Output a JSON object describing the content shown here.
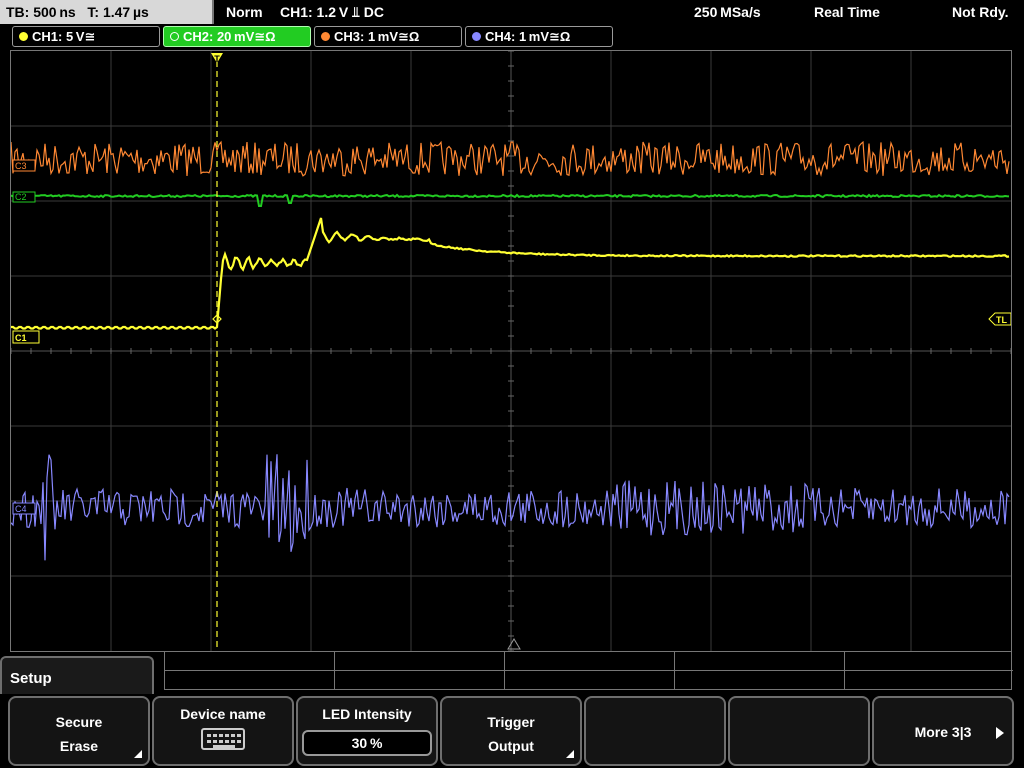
{
  "status": {
    "timebase": "TB: 500 ns",
    "trigger_time": "T: 1.47 µs",
    "mode": "Norm",
    "trigger_info": "CH1: 1.2 V ⫫ DC",
    "sample_rate": "250 MSa/s",
    "acq_mode": "Real Time",
    "state": "Not Rdy."
  },
  "channels": [
    {
      "label": "CH1: 5 V≅",
      "color": "#ffff33",
      "active": false
    },
    {
      "label": "CH2: 20 mV≅Ω",
      "color": "#22cc22",
      "active": true
    },
    {
      "label": "CH3: 1 mV≅Ω",
      "color": "#ff8833",
      "active": false
    },
    {
      "label": "CH4: 1 mV≅Ω",
      "color": "#8888ff",
      "active": false
    }
  ],
  "screen_markers": {
    "trigger_marker": "T",
    "ch1_ref": "C1",
    "ch3_ref": "C3",
    "ch2_ref": "C2",
    "ch4_ref": "C4",
    "trigger_level": "TL"
  },
  "menu": {
    "title": "Setup",
    "softkeys": [
      {
        "line1": "Secure",
        "line2": "Erase",
        "has_submenu": true
      },
      {
        "line1": "Device name",
        "icon": "keyboard-icon"
      },
      {
        "line1": "LED Intensity",
        "value": "30 %"
      },
      {
        "line1": "Trigger",
        "line2": "Output",
        "has_submenu": true
      },
      {
        "line1": ""
      },
      {
        "line1": ""
      },
      {
        "line1": "More 3|3",
        "icon": "arrow-right-icon"
      }
    ]
  },
  "colors": {
    "ch1": "#ffff33",
    "ch2": "#22cc22",
    "ch3": "#ff8833",
    "ch4": "#8888ff",
    "grid": "#4a4a4a"
  }
}
